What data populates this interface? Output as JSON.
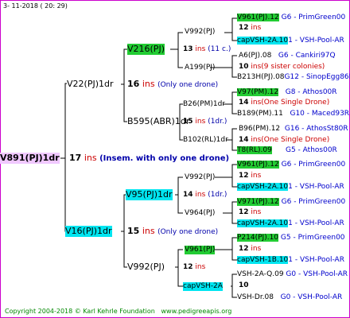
{
  "header": {
    "timestamp": "3- 11-2018 ( 20: 29)"
  },
  "tree": {
    "root": {
      "name": "V891(PJ)1dr",
      "ins_value": "17",
      "ins_label": "ins",
      "ins_note": "(Insem. with only one drone)"
    },
    "g1a": {
      "name": "V22(PJ)1dr",
      "ins_value": "16",
      "ins_label": "ins",
      "ins_note": "(Only one drone)"
    },
    "g1b": {
      "name": "V16(PJ)1dr",
      "ins_value": "15",
      "ins_label": "ins",
      "ins_note": "(Only one drone)"
    },
    "g2a": {
      "name": "V216(PJ)",
      "ins_value": "13",
      "ins_label": "ins",
      "ins_note": "(11 c.)"
    },
    "g2b": {
      "name": "B595(ABR)1dr",
      "ins_value": "15",
      "ins_label": "ins",
      "ins_note": "(1dr.)"
    },
    "g2c": {
      "name": "V95(PJ)1dr",
      "ins_value": "14",
      "ins_label": "ins",
      "ins_note": "(1dr.)"
    },
    "g2d": {
      "name": "V992(PJ)",
      "ins_value": "12",
      "ins_label": "ins"
    },
    "g3a": {
      "name": "V992(PJ)"
    },
    "g3b": {
      "name": "A199(PJ)"
    },
    "g3c": {
      "name": "B26(PM)1dr"
    },
    "g3d": {
      "name": "B102(RL)1dr"
    },
    "g3e": {
      "name": "V992(PJ)"
    },
    "g3f": {
      "name": "V964(PJ)"
    },
    "g3g": {
      "name": "V961(PJ)"
    },
    "g3h": {
      "name": "capVSH-2A"
    },
    "g4a": {
      "f_name": "V961(PJ).12",
      "f_loc": "G6 - PrimGreen00",
      "ins_value": "12",
      "ins_label": "ins",
      "m_name": "capVSH-2A.10",
      "m_loc": "1 - VSH-Pool-AR"
    },
    "g4b": {
      "f_name": "A6(PJ).08",
      "f_loc": "G6 - Cankiri97Q",
      "ins_value": "10",
      "ins_label": "ins(9 sister colonies)",
      "m_name": "B213H(PJ).08",
      "m_loc": "G12 - SinopEgg86R"
    },
    "g4c": {
      "f_name": "V97(PM).12",
      "f_loc": "G8 - Athos00R",
      "ins_value": "14",
      "ins_label": "ins(One Single Drone)",
      "m_name": "B189(PM).11",
      "m_loc": "G10 - Maced93R"
    },
    "g4d": {
      "f_name": "B96(PM).12",
      "f_loc": "G16 - AthosSt80R",
      "ins_value": "14",
      "ins_label": "ins(One Single Drone)",
      "m_name": "T8(RL).09",
      "m_loc": "G5 - Athos00R"
    },
    "g4e": {
      "f_name": "V961(PJ).12",
      "f_loc": "G6 - PrimGreen00",
      "ins_value": "12",
      "ins_label": "ins",
      "m_name": "capVSH-2A.10",
      "m_loc": "1 - VSH-Pool-AR"
    },
    "g4f": {
      "f_name": "V971(PJ).12",
      "f_loc": "G6 - PrimGreen00",
      "ins_value": "12",
      "ins_label": "ins",
      "m_name": "capVSH-2A.10",
      "m_loc": "1 - VSH-Pool-AR"
    },
    "g4g": {
      "f_name": "P214(PJ).10",
      "f_loc": "G5 - PrimGreen00",
      "ins_value": "12",
      "ins_label": "ins",
      "m_name": "capVSH-1B.10",
      "m_loc": "1 - VSH-Pool-AR"
    },
    "g4h": {
      "f_name": "VSH-2A-Q.09",
      "f_loc": "G0 - VSH-Pool-AR",
      "ins_value": "10",
      "m_name": "VSH-Dr.08",
      "m_loc": "G0 - VSH-Pool-AR"
    }
  },
  "footer": {
    "copyright": "Copyright 2004-2018 © Karl Kehrle Foundation",
    "website": "www.pedigreeapis.org"
  }
}
